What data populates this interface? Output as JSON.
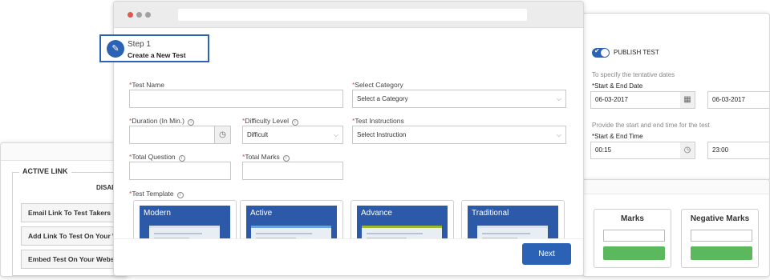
{
  "left_panel": {
    "legend": "ACTIVE LINK",
    "disable_label": "DISABL",
    "links": [
      "Email Link To Test Takers",
      "Add Link To Test On Your We",
      "Embed Test On Your Website"
    ]
  },
  "right_panel": {
    "publish_label": "PUBLISH TEST",
    "tentative_text": "To specify the tentative dates",
    "date_label": "*Start & End Date",
    "start_date": "06-03-2017",
    "end_date": "06-03-2017",
    "time_hint": "Provide the start and end time for the test",
    "time_label": "*Start & End Time",
    "start_time": "00:15",
    "end_time": "23:00",
    "calendar_icon": "calendar-icon",
    "clock_icon": "clock-icon"
  },
  "marks_panel": {
    "marks_title": "Marks",
    "negative_marks_title": "Negative Marks"
  },
  "wizard": {
    "step_number": "Step 1",
    "step_title": "Create a New Test",
    "step_icon": "pencil-icon"
  },
  "form": {
    "test_name_label": "Test Name",
    "category_label": "Select Category",
    "category_value": "Select a Category",
    "duration_label": "Duration (In Min.)",
    "difficulty_label": "Difficulty Level",
    "difficulty_value": "Difficult",
    "instructions_label": "Test Instructions",
    "instructions_value": "Select Instruction",
    "total_question_label": "Total Question",
    "total_marks_label": "Total Marks",
    "template_label": "Test Template",
    "required_marker": "*",
    "info_glyph": "i"
  },
  "templates": [
    "Modern",
    "Active",
    "Advance",
    "Traditional"
  ],
  "next_button": "Next",
  "colors": {
    "accent": "#2c62b5",
    "success": "#5cb85c",
    "window_dots": [
      "#e0574d",
      "#a0a0a0",
      "#a0a0a0"
    ],
    "template_accents": [
      "#d9e2ee",
      "#6aa4e0",
      "#9bb82e",
      "#d9e2ee"
    ]
  }
}
